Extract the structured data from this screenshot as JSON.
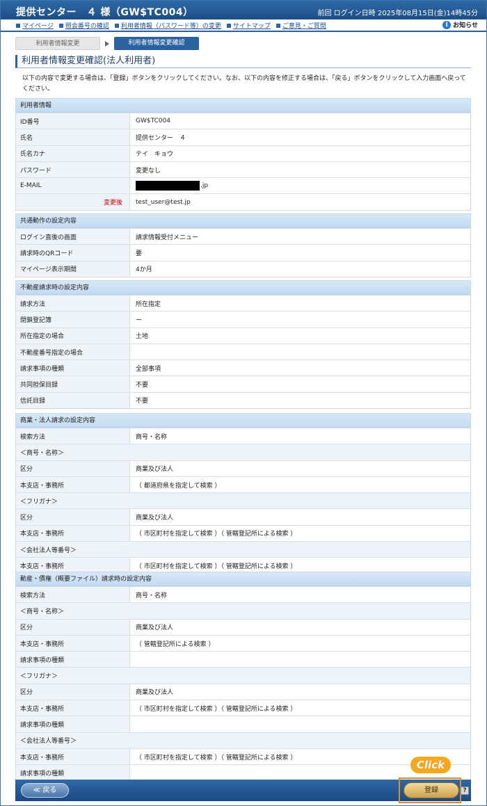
{
  "header": {
    "title": "提供センター　４ 様（GW$TC004）",
    "login_info": "前回 ログイン日時 2025年08月15日(金)14時45分"
  },
  "nav": {
    "links": [
      "マイページ",
      "照会番号の確認",
      "利用者情報（パスワード等）の変更",
      "サイトマップ",
      "ご意見・ご質問"
    ],
    "notice": "お知らせ"
  },
  "steps": {
    "step1": "利用者情報変更",
    "step2": "利用者情報変更確認"
  },
  "page_title": "利用者情報変更確認(法人利用者)",
  "description": "以下の内容で変更する場合は、「登録」ボタンをクリックしてください。なお、以下の内容を修正する場合は、「戻る」ボタンをクリックして入力画面へ戻ってください。",
  "user_info": {
    "heading": "利用者情報",
    "id_label": "ID番号",
    "id_value": "GW$TC004",
    "name_label": "氏名",
    "name_value": "提供センター　４",
    "kana_label": "氏名カナ",
    "kana_value": "テイ　キョウ",
    "password_label": "パスワード",
    "password_value": "変更なし",
    "email_label": "E-MAIL",
    "email_value_suffix": ".jp",
    "changed_label": "変更後",
    "changed_value": "test_user@test.jp"
  },
  "common": {
    "heading": "共通動作の設定内容",
    "rows": [
      {
        "label": "ログイン直後の画面",
        "value": "請求情報受付メニュー"
      },
      {
        "label": "請求時のQRコード",
        "value": "要"
      },
      {
        "label": "マイページ表示期間",
        "value": "4か月"
      }
    ]
  },
  "realestate": {
    "heading": "不動産請求時の設定内容",
    "rows": [
      {
        "label": "請求方法",
        "value": "所在指定"
      },
      {
        "label": "閉鎖登記簿",
        "value": "ー"
      },
      {
        "label": "所在指定の場合",
        "value": "土地"
      },
      {
        "label": "不動産番号指定の場合",
        "value": ""
      },
      {
        "label": "請求事項の種類",
        "value": "全部事項"
      },
      {
        "label": "共同担保目録",
        "value": "不要"
      },
      {
        "label": "信託目録",
        "value": "不要"
      }
    ]
  },
  "commercial": {
    "heading": "商業・法人請求の設定内容",
    "search_label": "検索方法",
    "search_value": "商号・名称",
    "sub1": "＜商号・名称＞",
    "kubun_label": "区分",
    "kubun_value1": "商業及び法人",
    "branch_label": "本支店・事務所",
    "branch_value1": "（ 都道府県を指定して検索 ）",
    "sub2": "＜フリガナ＞",
    "kubun_value2": "商業及び法人",
    "branch_value2": "（ 市区町村を指定して検索 ）（ 管轄登記所による検索 ）",
    "sub3": "＜会社法人等番号＞",
    "branch_value3": "（ 市区町村を指定して検索 ）（ 管轄登記所による検索 ）"
  },
  "movable": {
    "heading": "動産・債権（概要ファイル）請求時の設定内容",
    "search_label": "検索方法",
    "search_value": "商号・名称",
    "sub1": "＜商号・名称＞",
    "kubun_label": "区分",
    "kubun_value1": "商業及び法人",
    "branch_label": "本支店・事務所",
    "branch_value1": "（ 管轄登記所による検索 ）",
    "item_label": "請求事項の種類",
    "sub2": "＜フリガナ＞",
    "kubun_value2": "商業及び法人",
    "branch_value2": "（ 市区町村を指定して検索 ）（ 管轄登記所による検索 ）",
    "sub3": "＜会社法人等番号＞",
    "branch_value3": "（ 市区町村を指定して検索 ）（ 管轄登記所による検索 ）"
  },
  "footer": {
    "back_label": "≪ 戻る",
    "register_label": "登録",
    "help": "?",
    "click_badge": "Click"
  },
  "colors": {
    "header_bg": "#2a62a0",
    "section_head": "#c9dff4",
    "changed_text": "#d10000",
    "highlight": "#e08a2c"
  }
}
